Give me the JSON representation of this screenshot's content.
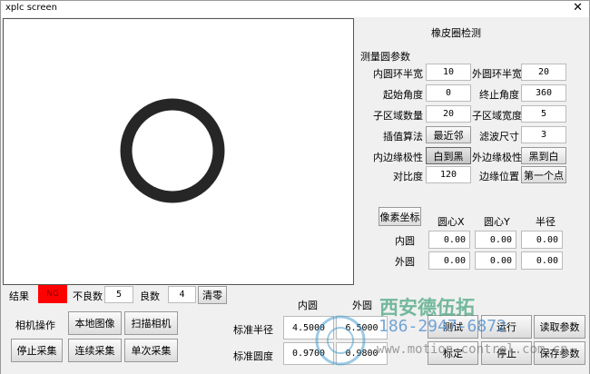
{
  "window": {
    "title": "xplc screen",
    "close": "✕"
  },
  "panel": {
    "title": "橡皮圈检测",
    "section": "测量圆参数"
  },
  "params": [
    {
      "l1": "内圆环半宽",
      "v1": "10",
      "l2": "外圆环半宽",
      "v2": "20"
    },
    {
      "l1": "起始角度",
      "v1": "0",
      "l2": "终止角度",
      "v2": "360"
    },
    {
      "l1": "子区域数量",
      "v1": "20",
      "l2": "子区域宽度",
      "v2": "5"
    },
    {
      "l1": "插值算法",
      "v1": "最近邻",
      "l2": "滤波尺寸",
      "v2": "3"
    },
    {
      "l1": "内边缘极性",
      "v1": "白到黑",
      "l2": "外边缘极性",
      "v2": "黑到白"
    },
    {
      "l1": "对比度",
      "v1": "120",
      "l2": "边缘位置",
      "v2": "第一个点"
    }
  ],
  "coords": {
    "button": "像素坐标",
    "headers": [
      "圆心X",
      "圆心Y",
      "半径"
    ],
    "rows": [
      {
        "label": "内圆",
        "values": [
          "0.00",
          "0.00",
          "0.00"
        ]
      },
      {
        "label": "外圆",
        "values": [
          "0.00",
          "0.00",
          "0.00"
        ]
      }
    ]
  },
  "result": {
    "label": "结果",
    "value": "NG",
    "color": "#ff0000",
    "bad_label": "不良数",
    "bad": "5",
    "good_label": "良数",
    "good": "4",
    "clear": "清零"
  },
  "camera": {
    "label": "相机操作",
    "local": "本地图像",
    "scan": "扫描相机",
    "stop": "停止采集",
    "continuous": "连续采集",
    "single": "单次采集"
  },
  "standard": {
    "inner": "内圆",
    "outer": "外圆",
    "radius_label": "标准半径",
    "radius": [
      "4.5000",
      "6.5000"
    ],
    "round_label": "标准圆度",
    "round": [
      "0.9700",
      "0.9800"
    ]
  },
  "actions": [
    "测试",
    "运行",
    "读取参数",
    "标定",
    "停止",
    "保存参数"
  ],
  "watermark": {
    "company": "西安德伍拓",
    "phone": "186-2947-6872",
    "url": "www.motion-control.com.cn"
  }
}
